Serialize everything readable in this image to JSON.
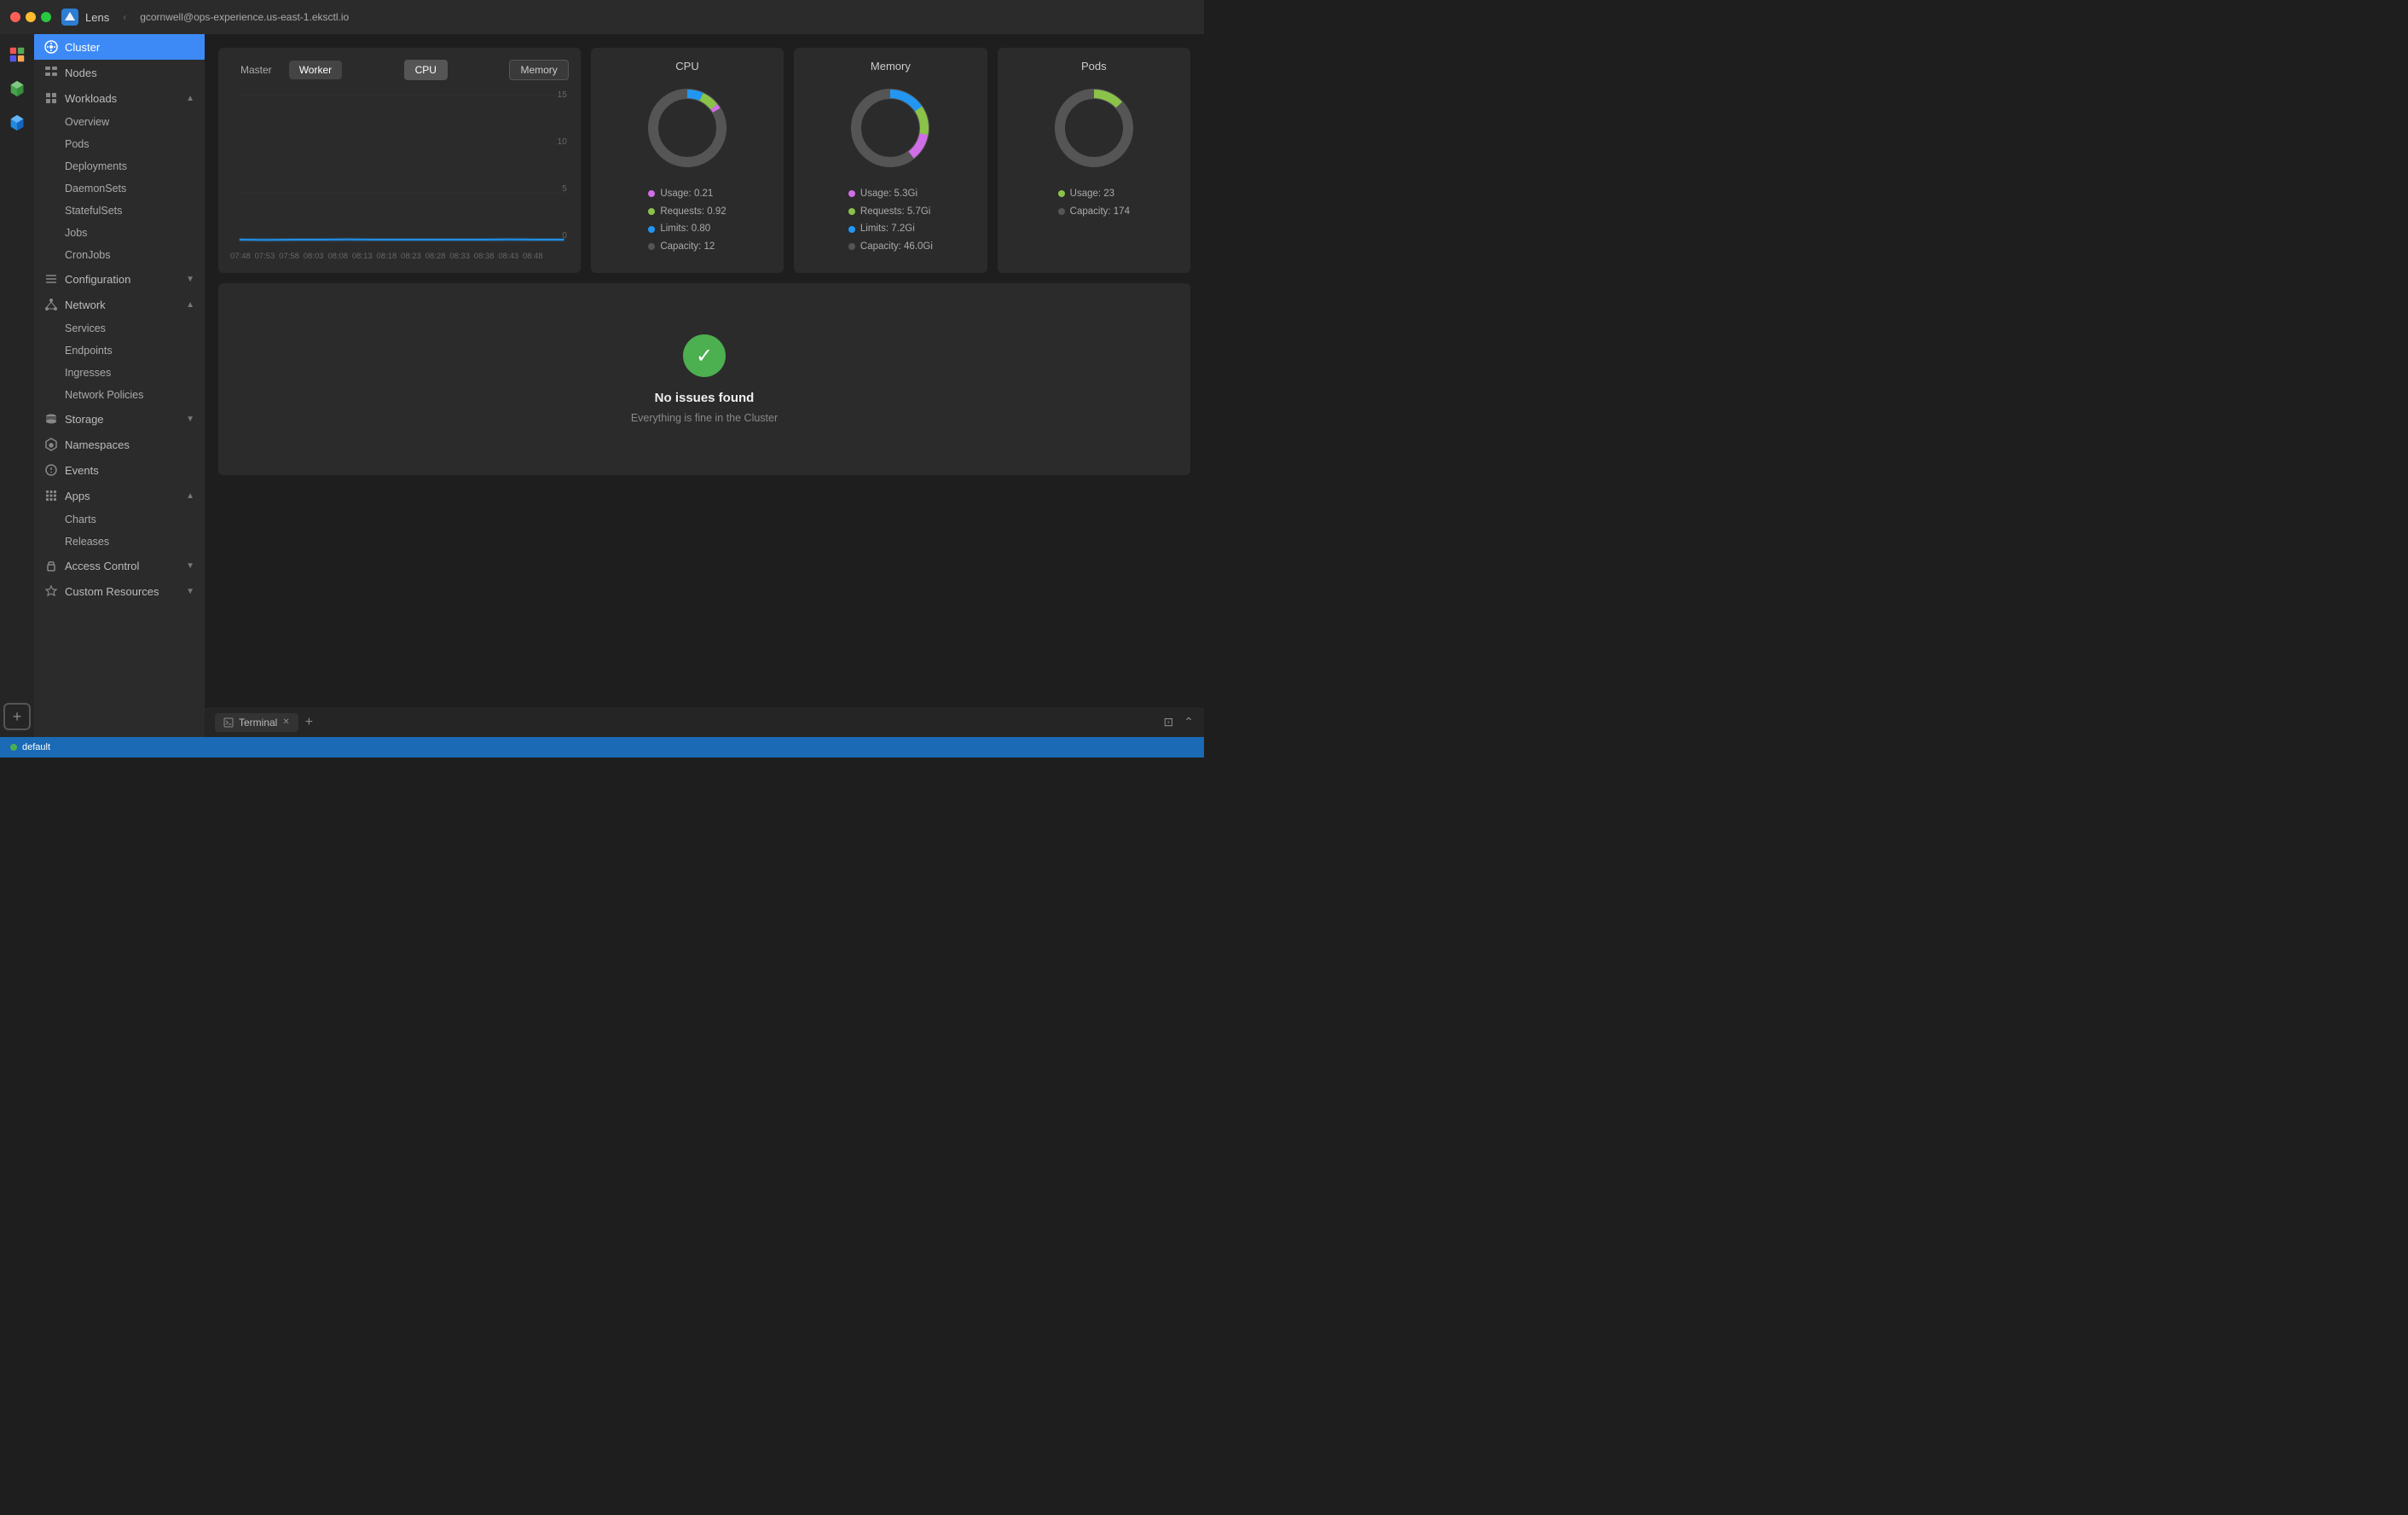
{
  "titlebar": {
    "app_name": "Lens",
    "url": "gcornwell@ops-experience.us-east-1.eksctl.io",
    "chevron_label": "‹"
  },
  "sidebar": {
    "cluster_label": "Cluster",
    "nodes_label": "Nodes",
    "workloads_label": "Workloads",
    "workloads_children": [
      "Overview",
      "Pods",
      "Deployments",
      "DaemonSets",
      "StatefulSets",
      "Jobs",
      "CronJobs"
    ],
    "configuration_label": "Configuration",
    "network_label": "Network",
    "network_children": [
      "Services",
      "Endpoints",
      "Ingresses",
      "Network Policies"
    ],
    "storage_label": "Storage",
    "namespaces_label": "Namespaces",
    "events_label": "Events",
    "apps_label": "Apps",
    "apps_children": [
      "Charts",
      "Releases"
    ],
    "access_control_label": "Access Control",
    "custom_resources_label": "Custom Resources"
  },
  "dashboard": {
    "master_btn": "Master",
    "worker_btn": "Worker",
    "cpu_btn": "CPU",
    "memory_btn": "Memory",
    "chart_y_labels": [
      "15",
      "10",
      "5",
      "0"
    ],
    "chart_x_labels": [
      "07:48",
      "07:53",
      "07:58",
      "08:03",
      "08:08",
      "08:13",
      "08:18",
      "08:23",
      "08:28",
      "08:33",
      "08:38",
      "08:43",
      "08:48"
    ],
    "cpu_panel": {
      "title": "CPU",
      "usage_label": "Usage: 0.21",
      "requests_label": "Requests: 0.92",
      "limits_label": "Limits: 0.80",
      "capacity_label": "Capacity: 12",
      "colors": {
        "usage": "#d06ee8",
        "requests": "#8bc34a",
        "limits": "#2196f3",
        "capacity": "#555"
      }
    },
    "memory_panel": {
      "title": "Memory",
      "usage_label": "Usage: 5.3Gi",
      "requests_label": "Requests: 5.7Gi",
      "limits_label": "Limits: 7.2Gi",
      "capacity_label": "Capacity: 46.0Gi",
      "colors": {
        "usage": "#d06ee8",
        "requests": "#8bc34a",
        "limits": "#2196f3",
        "capacity": "#555"
      }
    },
    "pods_panel": {
      "title": "Pods",
      "usage_label": "Usage: 23",
      "capacity_label": "Capacity: 174",
      "colors": {
        "usage": "#8bc34a",
        "capacity": "#555"
      }
    },
    "no_issues": {
      "title": "No issues found",
      "subtitle": "Everything is fine in the Cluster"
    }
  },
  "terminal": {
    "tab_label": "Terminal",
    "add_label": "+"
  },
  "statusbar": {
    "label": "default"
  }
}
